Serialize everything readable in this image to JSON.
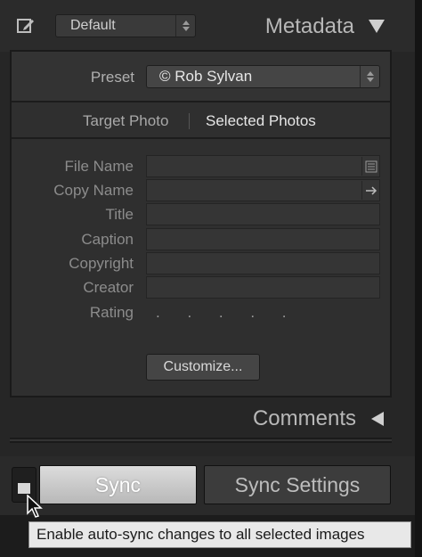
{
  "header": {
    "preset_label": "Default",
    "panel_title": "Metadata",
    "icons": {
      "edit": "edit-metadata-icon",
      "collapse": "triangle-down-icon",
      "stepper": "up-down-stepper-icon"
    }
  },
  "metadata": {
    "preset": {
      "label": "Preset",
      "value": "© Rob Sylvan"
    },
    "target": {
      "target_photo": "Target Photo",
      "selected_photos": "Selected Photos",
      "active": "selected_photos"
    },
    "fields": {
      "file_name": "File Name",
      "copy_name": "Copy Name",
      "title": "Title",
      "caption": "Caption",
      "copyright": "Copyright",
      "creator": "Creator",
      "rating": "Rating"
    },
    "rating_dots": ". . . . .",
    "customize_label": "Customize..."
  },
  "comments": {
    "title": "Comments"
  },
  "sync": {
    "sync_label": "Sync",
    "sync_settings_label": "Sync Settings",
    "tooltip": "Enable auto-sync changes to all selected images"
  },
  "colors": {
    "panel_bg": "#2f2f2f",
    "dark_bg": "#262626",
    "sync_button": "#cfcfcf",
    "tooltip_bg": "#e8e8e8"
  }
}
